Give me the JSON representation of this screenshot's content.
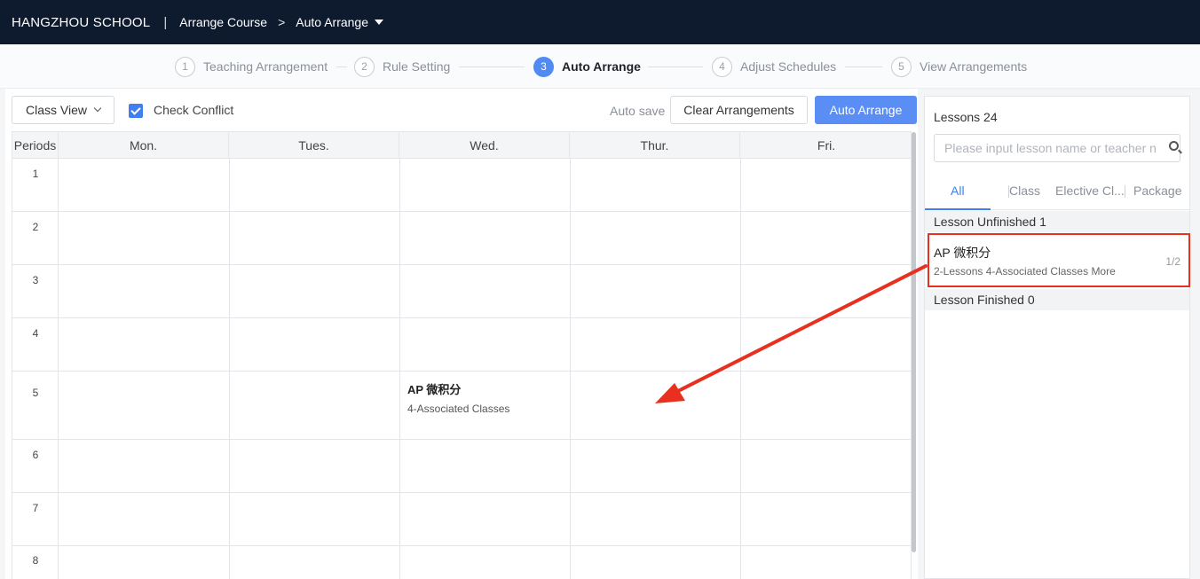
{
  "header": {
    "school": "HANGZHOU SCHOOL",
    "separator": "|",
    "breadcrumb_1": "Arrange Course",
    "breadcrumb_chevron": ">",
    "breadcrumb_2": "Auto Arrange"
  },
  "steps": [
    {
      "num": "1",
      "label": "Teaching Arrangement"
    },
    {
      "num": "2",
      "label": "Rule Setting"
    },
    {
      "num": "3",
      "label": "Auto Arrange"
    },
    {
      "num": "4",
      "label": "Adjust Schedules"
    },
    {
      "num": "5",
      "label": "View Arrangements"
    }
  ],
  "toolbar": {
    "view_select": "Class View",
    "check_conflict": "Check Conflict",
    "auto_save": "Auto save",
    "clear_label": "Clear Arrangements",
    "auto_arrange_label": "Auto Arrange"
  },
  "timetable": {
    "periods_header": "Periods",
    "days": [
      "Mon.",
      "Tues.",
      "Wed.",
      "Thur.",
      "Fri."
    ],
    "periods": [
      "1",
      "2",
      "3",
      "4",
      "5",
      "6",
      "7",
      "8"
    ],
    "placed_lesson": {
      "title": "AP 微积分",
      "subtitle": "4-Associated Classes"
    }
  },
  "side": {
    "lessons_count": "Lessons 24",
    "search_placeholder": "Please input lesson name or teacher n",
    "tabs": [
      "All",
      "Class",
      "Elective Cl...",
      "Package"
    ],
    "unfinished_header": "Lesson Unfinished 1",
    "lesson": {
      "name": "AP 微积分",
      "meta": "2-Lessons 4-Associated Classes",
      "more": "More",
      "progress": "1/2"
    },
    "finished_header": "Lesson Finished 0"
  },
  "colors": {
    "topbar": "#0e1a2d",
    "accent": "#5a8ef4",
    "annotation": "#e8301f"
  }
}
